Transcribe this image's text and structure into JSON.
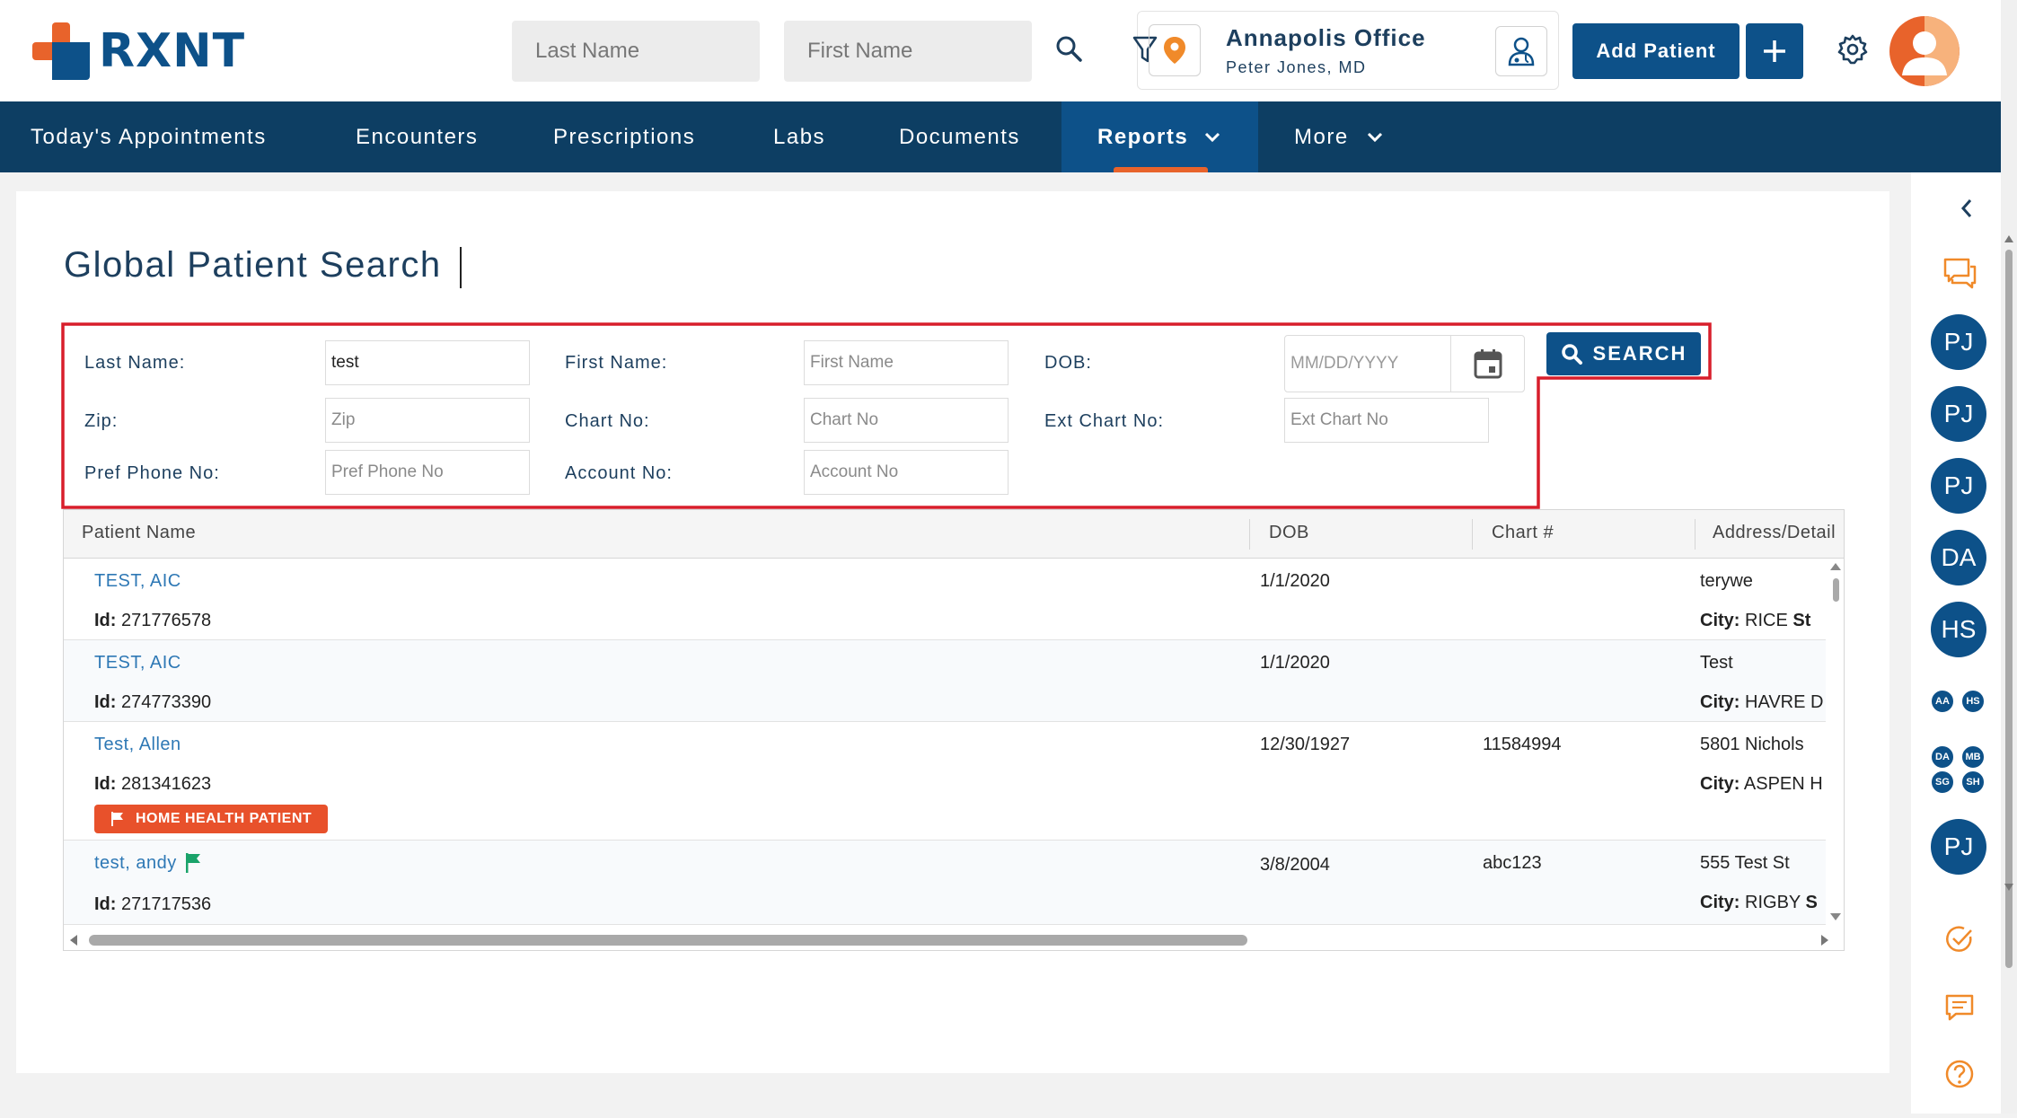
{
  "brand": {
    "name": "RXNT"
  },
  "header": {
    "last_name_placeholder": "Last Name",
    "first_name_placeholder": "First Name",
    "office_name": "Annapolis Office",
    "office_provider": "Peter Jones, MD",
    "add_patient_label": "Add Patient"
  },
  "nav": {
    "items": [
      {
        "label": "Today's Appointments"
      },
      {
        "label": "Encounters"
      },
      {
        "label": "Prescriptions"
      },
      {
        "label": "Labs"
      },
      {
        "label": "Documents"
      },
      {
        "label": "Reports"
      },
      {
        "label": "More"
      }
    ],
    "active": "Reports"
  },
  "page": {
    "title": "Global Patient Search"
  },
  "search_form": {
    "last_name": {
      "label": "Last Name:",
      "value": "test"
    },
    "first_name": {
      "label": "First Name:",
      "placeholder": "First Name"
    },
    "dob": {
      "label": "DOB:",
      "placeholder": "MM/DD/YYYY"
    },
    "zip": {
      "label": "Zip:",
      "placeholder": "Zip"
    },
    "chart_no": {
      "label": "Chart No:",
      "placeholder": "Chart No"
    },
    "ext_chart_no": {
      "label": "Ext Chart No:",
      "placeholder": "Ext Chart No"
    },
    "pref_phone": {
      "label": "Pref Phone No:",
      "placeholder": "Pref Phone No"
    },
    "account_no": {
      "label": "Account No:",
      "placeholder": "Account No"
    },
    "search_label": "SEARCH"
  },
  "results": {
    "columns": [
      "Patient Name",
      "DOB",
      "Chart #",
      "Address/Detail"
    ],
    "id_label": "Id:",
    "city_label": "City:",
    "rows": [
      {
        "name": "TEST, AIC",
        "id": "271776578",
        "dob": "1/1/2020",
        "chart": "",
        "address": "terywe",
        "city": "RICE",
        "extra": "St"
      },
      {
        "name": "TEST, AIC",
        "id": "274773390",
        "dob": "1/1/2020",
        "chart": "",
        "address": "Test",
        "city": "HAVRE D",
        "extra": ""
      },
      {
        "name": "Test, Allen",
        "id": "281341623",
        "dob": "12/30/1927",
        "chart": "11584994",
        "address": "5801 Nichols",
        "city": "ASPEN H",
        "extra": "",
        "badge": "HOME HEALTH PATIENT"
      },
      {
        "name": "test, andy",
        "id": "271717536",
        "dob": "3/8/2004",
        "chart": "abc123",
        "address": "555 Test St",
        "city": "RIGBY",
        "extra": "S"
      }
    ]
  },
  "sidebar": {
    "avatars_big": [
      "PJ",
      "PJ",
      "PJ",
      "DA",
      "HS"
    ],
    "avatars_small_pair": [
      "AA",
      "HS"
    ],
    "avatars_small_group": [
      "DA",
      "MB",
      "SG",
      "SH"
    ],
    "avatar_last": "PJ"
  },
  "colors": {
    "brand_blue": "#0d5189",
    "nav_dark": "#0d3e63",
    "accent_orange": "#e8632b",
    "highlight_red": "#d81e2b",
    "link_blue": "#2e78b5"
  }
}
